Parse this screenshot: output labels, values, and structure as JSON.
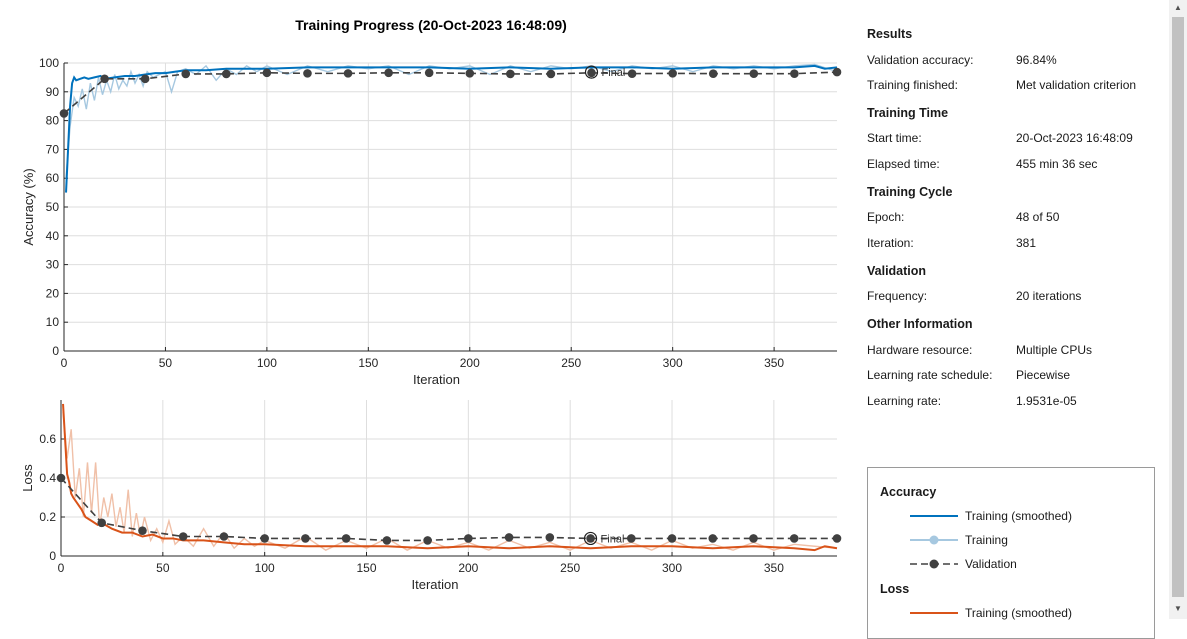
{
  "colors": {
    "acc_smoothed": "#0072bd",
    "acc_raw": "#a6c8e0",
    "loss_smoothed": "#d95319",
    "loss_raw": "#f0c0a8",
    "validation": "#404040",
    "grid": "#dedede",
    "axes_bg": "#ffffff"
  },
  "chart_data": [
    {
      "type": "line",
      "title": "Training Progress (20-Oct-2023 16:48:09)",
      "xlabel": "Iteration",
      "ylabel": "Accuracy (%)",
      "xlim": [
        0,
        381
      ],
      "ylim": [
        0,
        100
      ],
      "xticks": [
        0,
        50,
        100,
        150,
        200,
        250,
        300,
        350
      ],
      "yticks": [
        0,
        10,
        20,
        30,
        40,
        50,
        60,
        70,
        80,
        90,
        100
      ],
      "grid": true,
      "final_marker": {
        "x": 260,
        "y": 96.84,
        "label": "Final"
      },
      "series": [
        {
          "name": "Training (smoothed)",
          "x": [
            1,
            2,
            3,
            4,
            5,
            6,
            8,
            10,
            12,
            15,
            18,
            20,
            25,
            30,
            35,
            40,
            45,
            50,
            55,
            60,
            70,
            80,
            90,
            100,
            120,
            140,
            160,
            180,
            200,
            220,
            240,
            260,
            280,
            300,
            320,
            340,
            360,
            370,
            375,
            381
          ],
          "y": [
            55,
            70,
            85,
            93,
            95,
            94,
            94.5,
            95,
            94.5,
            95,
            95.5,
            94.5,
            95,
            95.5,
            95.5,
            96,
            96.5,
            96.5,
            97,
            97.5,
            97.5,
            98,
            98,
            98,
            98.5,
            98.5,
            98.5,
            98.5,
            98,
            98.5,
            98,
            98.5,
            98.5,
            98,
            98.5,
            98.5,
            98.5,
            99,
            98,
            98.5
          ]
        },
        {
          "name": "Training",
          "x": [
            1,
            3,
            5,
            7,
            9,
            11,
            13,
            15,
            17,
            19,
            21,
            23,
            25,
            27,
            29,
            31,
            33,
            35,
            37,
            39,
            41,
            44,
            47,
            50,
            53,
            56,
            60,
            65,
            70,
            75,
            80,
            85,
            90,
            95,
            100,
            110,
            120,
            130,
            140,
            150,
            160,
            170,
            180,
            190,
            200,
            210,
            220,
            230,
            240,
            250,
            260,
            270,
            280,
            290,
            300,
            310,
            320,
            330,
            340,
            350,
            360,
            370,
            381
          ],
          "y": [
            60,
            78,
            88,
            85,
            91,
            84,
            93,
            87,
            95,
            89,
            94,
            90,
            96,
            91,
            94,
            92,
            97,
            93,
            96,
            92,
            97,
            95,
            96,
            97,
            90,
            97,
            98,
            96,
            99,
            94,
            98,
            96,
            99,
            97,
            99,
            96,
            99,
            97,
            99,
            98,
            99,
            96,
            99,
            98,
            99,
            96,
            99,
            97,
            99,
            98,
            99,
            97,
            99,
            98,
            99,
            97,
            99,
            98,
            99,
            98,
            99,
            100,
            97
          ]
        },
        {
          "name": "Validation",
          "x": [
            0,
            20,
            40,
            60,
            80,
            100,
            120,
            140,
            160,
            180,
            200,
            220,
            240,
            260,
            280,
            300,
            320,
            340,
            360,
            381
          ],
          "y": [
            82.5,
            94.5,
            94.5,
            96.2,
            96.2,
            96.6,
            96.4,
            96.4,
            96.6,
            96.6,
            96.4,
            96.2,
            96.2,
            96.6,
            96.3,
            96.4,
            96.3,
            96.3,
            96.3,
            96.84
          ]
        }
      ]
    },
    {
      "type": "line",
      "xlabel": "Iteration",
      "ylabel": "Loss",
      "xlim": [
        0,
        381
      ],
      "ylim": [
        0,
        0.8
      ],
      "xticks": [
        0,
        50,
        100,
        150,
        200,
        250,
        300,
        350
      ],
      "yticks": [
        0,
        0.2,
        0.4,
        0.6
      ],
      "yticklabels": [
        "0",
        "0.2",
        "0.4",
        "0.6"
      ],
      "grid": true,
      "final_marker": {
        "x": 260,
        "y": 0.09,
        "label": "Final"
      },
      "series": [
        {
          "name": "Training (smoothed)",
          "x": [
            1,
            2,
            3,
            4,
            5,
            6,
            8,
            10,
            12,
            15,
            18,
            20,
            25,
            30,
            35,
            40,
            45,
            50,
            55,
            60,
            70,
            80,
            90,
            100,
            120,
            140,
            160,
            180,
            200,
            220,
            240,
            260,
            280,
            300,
            320,
            340,
            360,
            370,
            375,
            381
          ],
          "y": [
            0.78,
            0.6,
            0.42,
            0.38,
            0.32,
            0.3,
            0.27,
            0.24,
            0.2,
            0.18,
            0.16,
            0.17,
            0.14,
            0.12,
            0.12,
            0.1,
            0.11,
            0.09,
            0.09,
            0.08,
            0.08,
            0.07,
            0.06,
            0.06,
            0.05,
            0.05,
            0.05,
            0.04,
            0.05,
            0.04,
            0.05,
            0.04,
            0.05,
            0.05,
            0.04,
            0.05,
            0.04,
            0.03,
            0.05,
            0.04
          ]
        },
        {
          "name": "Training",
          "x": [
            1,
            3,
            5,
            7,
            9,
            11,
            13,
            15,
            17,
            19,
            21,
            23,
            25,
            27,
            29,
            31,
            33,
            35,
            37,
            39,
            41,
            44,
            47,
            50,
            53,
            56,
            60,
            65,
            70,
            75,
            80,
            85,
            90,
            95,
            100,
            110,
            120,
            130,
            140,
            150,
            160,
            170,
            180,
            190,
            200,
            210,
            220,
            230,
            240,
            250,
            260,
            270,
            280,
            290,
            300,
            310,
            320,
            330,
            340,
            350,
            360,
            370,
            381
          ],
          "y": [
            0.74,
            0.5,
            0.65,
            0.3,
            0.45,
            0.2,
            0.48,
            0.22,
            0.48,
            0.15,
            0.3,
            0.2,
            0.32,
            0.15,
            0.25,
            0.12,
            0.34,
            0.1,
            0.22,
            0.1,
            0.2,
            0.08,
            0.14,
            0.07,
            0.18,
            0.06,
            0.1,
            0.05,
            0.14,
            0.05,
            0.12,
            0.04,
            0.09,
            0.05,
            0.08,
            0.04,
            0.1,
            0.03,
            0.08,
            0.04,
            0.09,
            0.03,
            0.08,
            0.04,
            0.07,
            0.03,
            0.08,
            0.04,
            0.07,
            0.03,
            0.08,
            0.04,
            0.07,
            0.03,
            0.08,
            0.04,
            0.06,
            0.03,
            0.07,
            0.03,
            0.06,
            0.05,
            0.04
          ]
        },
        {
          "name": "Validation",
          "x": [
            0,
            20,
            40,
            60,
            80,
            100,
            120,
            140,
            160,
            180,
            200,
            220,
            240,
            260,
            280,
            300,
            320,
            340,
            360,
            381
          ],
          "y": [
            0.4,
            0.17,
            0.13,
            0.1,
            0.1,
            0.09,
            0.09,
            0.09,
            0.08,
            0.08,
            0.09,
            0.095,
            0.095,
            0.09,
            0.09,
            0.09,
            0.09,
            0.09,
            0.09,
            0.09
          ]
        }
      ]
    }
  ],
  "panel": {
    "results": {
      "title": "Results",
      "validation_accuracy_label": "Validation accuracy:",
      "validation_accuracy_value": "96.84%",
      "training_finished_label": "Training finished:",
      "training_finished_value": "Met validation criterion"
    },
    "training_time": {
      "title": "Training Time",
      "start_time_label": "Start time:",
      "start_time_value": "20-Oct-2023 16:48:09",
      "elapsed_time_label": "Elapsed time:",
      "elapsed_time_value": "455 min 36 sec"
    },
    "training_cycle": {
      "title": "Training Cycle",
      "epoch_label": "Epoch:",
      "epoch_value": "48 of 50",
      "iteration_label": "Iteration:",
      "iteration_value": "381"
    },
    "validation": {
      "title": "Validation",
      "frequency_label": "Frequency:",
      "frequency_value": "20 iterations"
    },
    "other_information": {
      "title": "Other Information",
      "hardware_label": "Hardware resource:",
      "hardware_value": "Multiple CPUs",
      "lr_schedule_label": "Learning rate schedule:",
      "lr_schedule_value": "Piecewise",
      "lr_label": "Learning rate:",
      "lr_value": "1.9531e-05"
    }
  },
  "legend": {
    "accuracy_title": "Accuracy",
    "acc_smoothed": "Training (smoothed)",
    "acc_training": "Training",
    "acc_validation": "Validation",
    "loss_title": "Loss",
    "loss_smoothed": "Training (smoothed)"
  },
  "scrollbar": {
    "up_icon": "▲",
    "down_icon": "▼"
  }
}
